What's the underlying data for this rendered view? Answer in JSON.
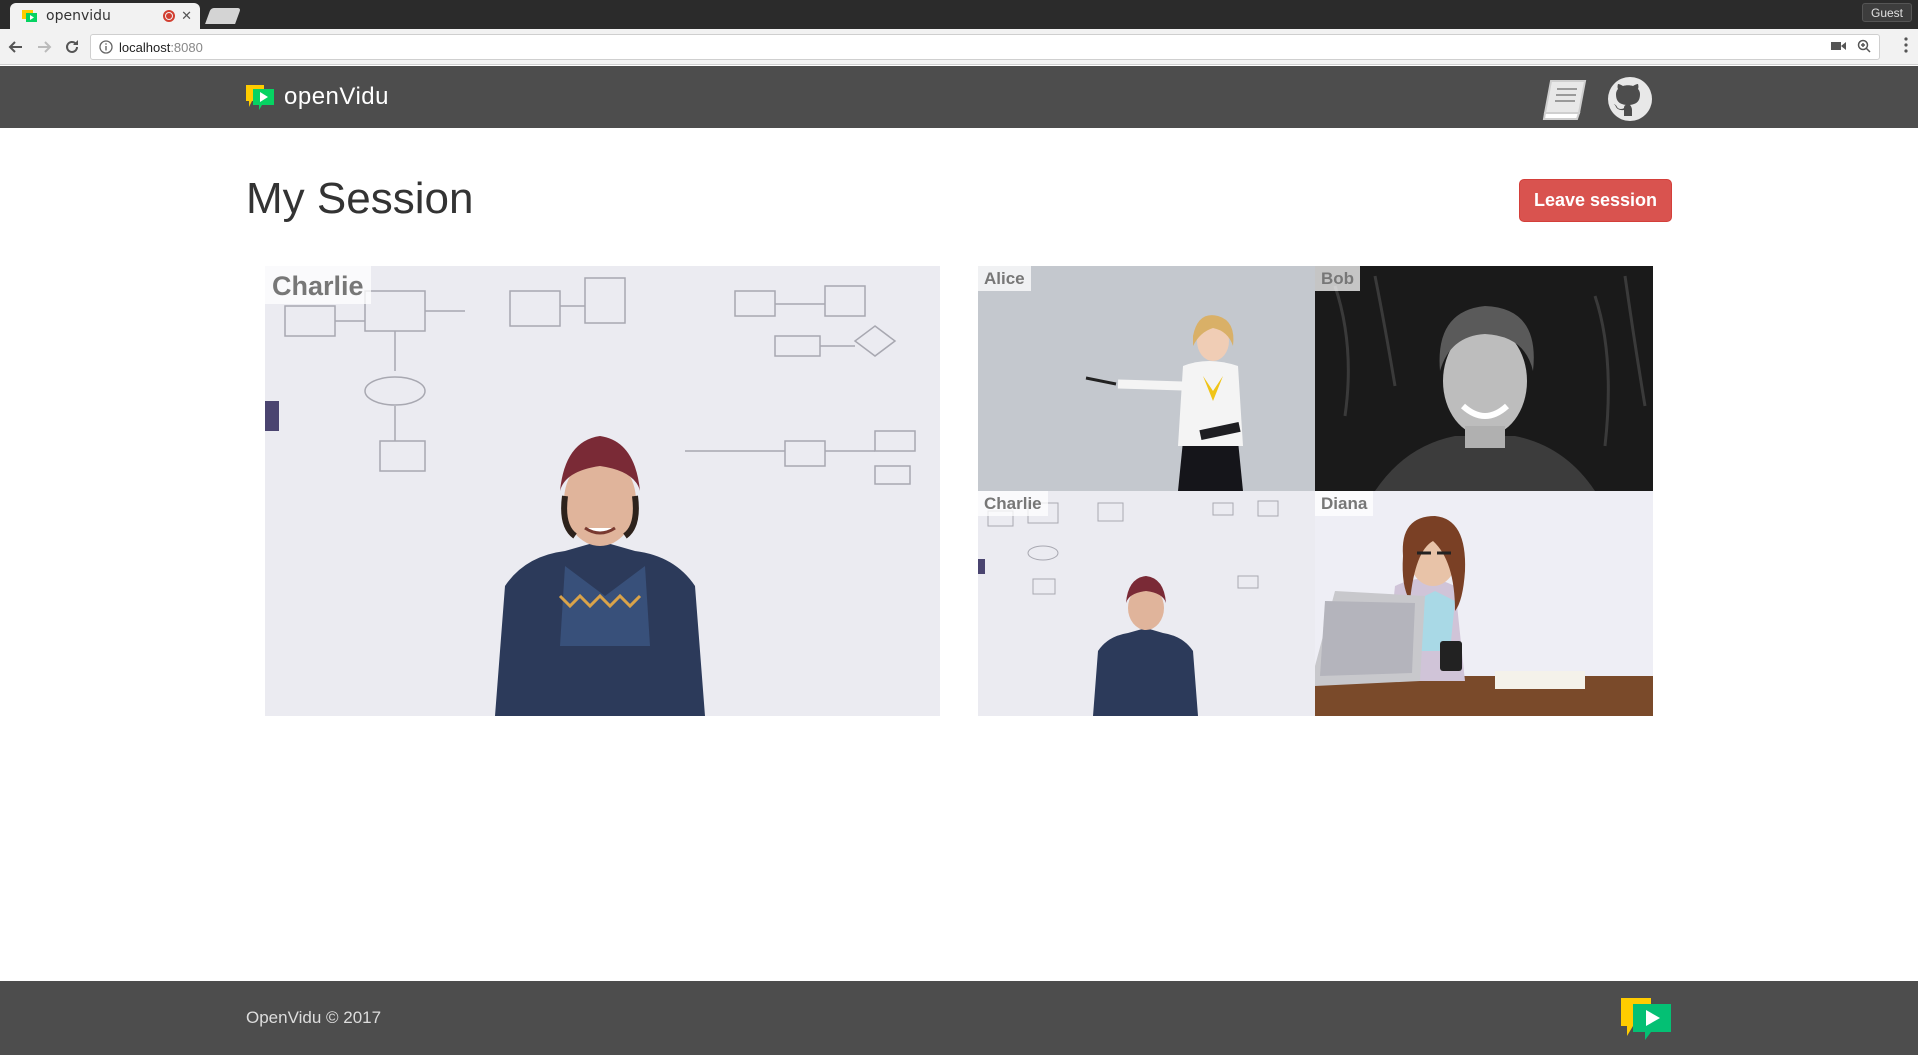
{
  "browser": {
    "tab_title": "openvidu",
    "guest_label": "Guest",
    "url_host": "localhost",
    "url_port": ":8080"
  },
  "navbar": {
    "brand": "openVidu",
    "icons": [
      "book-icon",
      "github-icon"
    ]
  },
  "session": {
    "title": "My Session",
    "leave_label": "Leave session",
    "main_video": {
      "name": "Charlie"
    },
    "participants": [
      {
        "name": "Alice"
      },
      {
        "name": "Bob"
      },
      {
        "name": "Charlie"
      },
      {
        "name": "Diana"
      }
    ]
  },
  "footer": {
    "text": "OpenVidu © 2017"
  },
  "colors": {
    "navbar": "#4d4d4d",
    "leave_button": "#d9534f",
    "logo_yellow": "#ffcc00",
    "logo_green": "#06d362",
    "logo_blue": "#0088aa"
  }
}
